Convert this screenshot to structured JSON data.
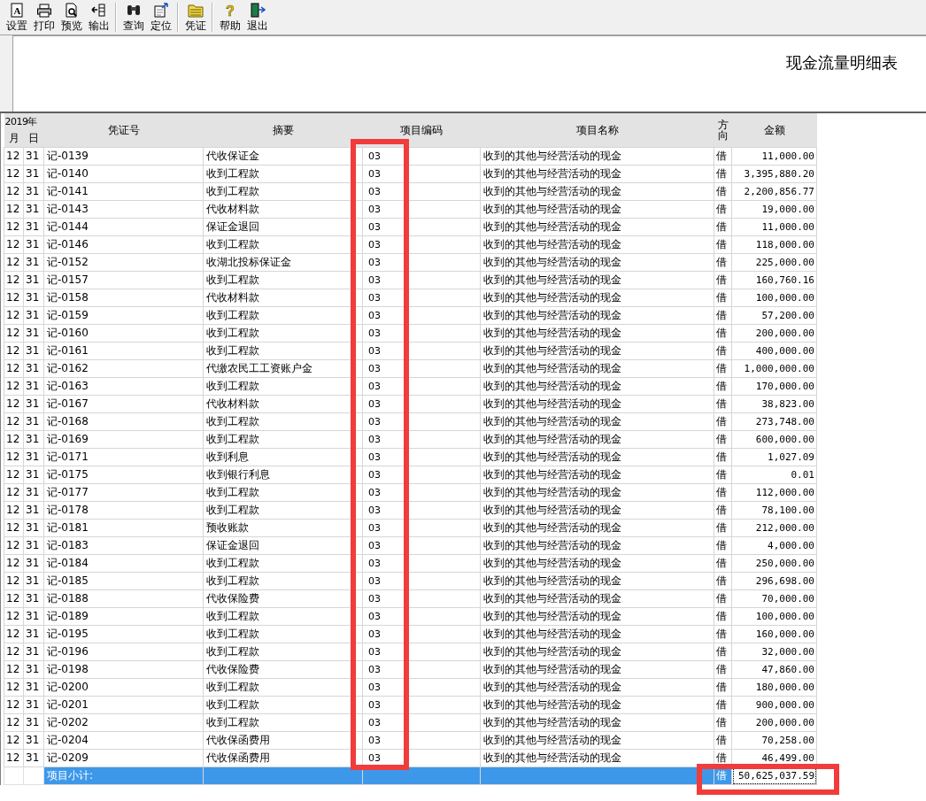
{
  "toolbar": [
    [
      {
        "glyph": "A",
        "label": "设置"
      },
      {
        "label": "打印"
      },
      {
        "label": "预览"
      },
      {
        "label": "输出"
      }
    ],
    [
      {
        "label": "查询"
      },
      {
        "label": "定位"
      }
    ],
    [
      {
        "label": "凭证"
      }
    ],
    [
      {
        "glyph": "?",
        "label": "帮助"
      },
      {
        "label": "退出"
      }
    ]
  ],
  "report_title": "现金流量明细表",
  "table": {
    "year_header": "2019年",
    "columns": [
      "月",
      "日",
      "凭证号",
      "摘要",
      "项目编码",
      "项目名称",
      "方向",
      "金额"
    ],
    "rows": [
      {
        "month": "12",
        "day": "31",
        "voucher": "记-0139",
        "summary": "代收保证金",
        "code": "03",
        "name": "收到的其他与经营活动的现金",
        "direction": "借",
        "amount": "11,000.00"
      },
      {
        "month": "12",
        "day": "31",
        "voucher": "记-0140",
        "summary": "收到工程款",
        "code": "03",
        "name": "收到的其他与经营活动的现金",
        "direction": "借",
        "amount": "3,395,880.20"
      },
      {
        "month": "12",
        "day": "31",
        "voucher": "记-0141",
        "summary": "收到工程款",
        "code": "03",
        "name": "收到的其他与经营活动的现金",
        "direction": "借",
        "amount": "2,200,856.77"
      },
      {
        "month": "12",
        "day": "31",
        "voucher": "记-0143",
        "summary": "代收材料款",
        "code": "03",
        "name": "收到的其他与经营活动的现金",
        "direction": "借",
        "amount": "19,000.00"
      },
      {
        "month": "12",
        "day": "31",
        "voucher": "记-0144",
        "summary": "保证金退回",
        "code": "03",
        "name": "收到的其他与经营活动的现金",
        "direction": "借",
        "amount": "11,000.00"
      },
      {
        "month": "12",
        "day": "31",
        "voucher": "记-0146",
        "summary": "收到工程款",
        "code": "03",
        "name": "收到的其他与经营活动的现金",
        "direction": "借",
        "amount": "118,000.00"
      },
      {
        "month": "12",
        "day": "31",
        "voucher": "记-0152",
        "summary": "收湖北投标保证金",
        "code": "03",
        "name": "收到的其他与经营活动的现金",
        "direction": "借",
        "amount": "225,000.00"
      },
      {
        "month": "12",
        "day": "31",
        "voucher": "记-0157",
        "summary": "收到工程款",
        "code": "03",
        "name": "收到的其他与经营活动的现金",
        "direction": "借",
        "amount": "160,760.16"
      },
      {
        "month": "12",
        "day": "31",
        "voucher": "记-0158",
        "summary": "代收材料款",
        "code": "03",
        "name": "收到的其他与经营活动的现金",
        "direction": "借",
        "amount": "100,000.00"
      },
      {
        "month": "12",
        "day": "31",
        "voucher": "记-0159",
        "summary": "收到工程款",
        "code": "03",
        "name": "收到的其他与经营活动的现金",
        "direction": "借",
        "amount": "57,200.00"
      },
      {
        "month": "12",
        "day": "31",
        "voucher": "记-0160",
        "summary": "收到工程款",
        "code": "03",
        "name": "收到的其他与经营活动的现金",
        "direction": "借",
        "amount": "200,000.00"
      },
      {
        "month": "12",
        "day": "31",
        "voucher": "记-0161",
        "summary": "收到工程款",
        "code": "03",
        "name": "收到的其他与经营活动的现金",
        "direction": "借",
        "amount": "400,000.00"
      },
      {
        "month": "12",
        "day": "31",
        "voucher": "记-0162",
        "summary": "代缴农民工工资账户金",
        "code": "03",
        "name": "收到的其他与经营活动的现金",
        "direction": "借",
        "amount": "1,000,000.00"
      },
      {
        "month": "12",
        "day": "31",
        "voucher": "记-0163",
        "summary": "收到工程款",
        "code": "03",
        "name": "收到的其他与经营活动的现金",
        "direction": "借",
        "amount": "170,000.00"
      },
      {
        "month": "12",
        "day": "31",
        "voucher": "记-0167",
        "summary": "代收材料款",
        "code": "03",
        "name": "收到的其他与经营活动的现金",
        "direction": "借",
        "amount": "38,823.00"
      },
      {
        "month": "12",
        "day": "31",
        "voucher": "记-0168",
        "summary": "收到工程款",
        "code": "03",
        "name": "收到的其他与经营活动的现金",
        "direction": "借",
        "amount": "273,748.00"
      },
      {
        "month": "12",
        "day": "31",
        "voucher": "记-0169",
        "summary": "收到工程款",
        "code": "03",
        "name": "收到的其他与经营活动的现金",
        "direction": "借",
        "amount": "600,000.00"
      },
      {
        "month": "12",
        "day": "31",
        "voucher": "记-0171",
        "summary": "收到利息",
        "code": "03",
        "name": "收到的其他与经营活动的现金",
        "direction": "借",
        "amount": "1,027.09"
      },
      {
        "month": "12",
        "day": "31",
        "voucher": "记-0175",
        "summary": "收到银行利息",
        "code": "03",
        "name": "收到的其他与经营活动的现金",
        "direction": "借",
        "amount": "0.01"
      },
      {
        "month": "12",
        "day": "31",
        "voucher": "记-0177",
        "summary": "收到工程款",
        "code": "03",
        "name": "收到的其他与经营活动的现金",
        "direction": "借",
        "amount": "112,000.00"
      },
      {
        "month": "12",
        "day": "31",
        "voucher": "记-0178",
        "summary": "收到工程款",
        "code": "03",
        "name": "收到的其他与经营活动的现金",
        "direction": "借",
        "amount": "78,100.00"
      },
      {
        "month": "12",
        "day": "31",
        "voucher": "记-0181",
        "summary": "预收账款",
        "code": "03",
        "name": "收到的其他与经营活动的现金",
        "direction": "借",
        "amount": "212,000.00"
      },
      {
        "month": "12",
        "day": "31",
        "voucher": "记-0183",
        "summary": "保证金退回",
        "code": "03",
        "name": "收到的其他与经营活动的现金",
        "direction": "借",
        "amount": "4,000.00"
      },
      {
        "month": "12",
        "day": "31",
        "voucher": "记-0184",
        "summary": "收到工程款",
        "code": "03",
        "name": "收到的其他与经营活动的现金",
        "direction": "借",
        "amount": "250,000.00"
      },
      {
        "month": "12",
        "day": "31",
        "voucher": "记-0185",
        "summary": "收到工程款",
        "code": "03",
        "name": "收到的其他与经营活动的现金",
        "direction": "借",
        "amount": "296,698.00"
      },
      {
        "month": "12",
        "day": "31",
        "voucher": "记-0188",
        "summary": "代收保险费",
        "code": "03",
        "name": "收到的其他与经营活动的现金",
        "direction": "借",
        "amount": "70,000.00"
      },
      {
        "month": "12",
        "day": "31",
        "voucher": "记-0189",
        "summary": "收到工程款",
        "code": "03",
        "name": "收到的其他与经营活动的现金",
        "direction": "借",
        "amount": "100,000.00"
      },
      {
        "month": "12",
        "day": "31",
        "voucher": "记-0195",
        "summary": "收到工程款",
        "code": "03",
        "name": "收到的其他与经营活动的现金",
        "direction": "借",
        "amount": "160,000.00"
      },
      {
        "month": "12",
        "day": "31",
        "voucher": "记-0196",
        "summary": "收到工程款",
        "code": "03",
        "name": "收到的其他与经营活动的现金",
        "direction": "借",
        "amount": "32,000.00"
      },
      {
        "month": "12",
        "day": "31",
        "voucher": "记-0198",
        "summary": "代收保险费",
        "code": "03",
        "name": "收到的其他与经营活动的现金",
        "direction": "借",
        "amount": "47,860.00"
      },
      {
        "month": "12",
        "day": "31",
        "voucher": "记-0200",
        "summary": "收到工程款",
        "code": "03",
        "name": "收到的其他与经营活动的现金",
        "direction": "借",
        "amount": "180,000.00"
      },
      {
        "month": "12",
        "day": "31",
        "voucher": "记-0201",
        "summary": "收到工程款",
        "code": "03",
        "name": "收到的其他与经营活动的现金",
        "direction": "借",
        "amount": "900,000.00"
      },
      {
        "month": "12",
        "day": "31",
        "voucher": "记-0202",
        "summary": "收到工程款",
        "code": "03",
        "name": "收到的其他与经营活动的现金",
        "direction": "借",
        "amount": "200,000.00"
      },
      {
        "month": "12",
        "day": "31",
        "voucher": "记-0204",
        "summary": "代收保函费用",
        "code": "03",
        "name": "收到的其他与经营活动的现金",
        "direction": "借",
        "amount": "70,258.00"
      },
      {
        "month": "12",
        "day": "31",
        "voucher": "记-0209",
        "summary": "代收保函费用",
        "code": "03",
        "name": "收到的其他与经营活动的现金",
        "direction": "借",
        "amount": "46,499.00"
      }
    ],
    "total": {
      "label": "项目小计:",
      "direction": "借",
      "amount": "50,625,037.59",
      "selected": true
    }
  }
}
